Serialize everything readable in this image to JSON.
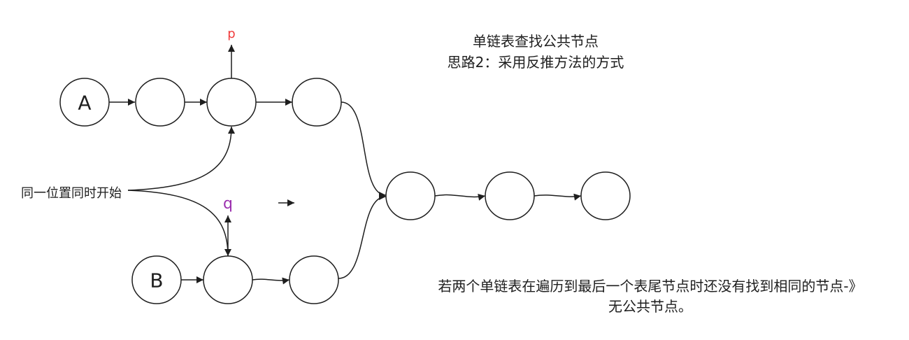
{
  "title": {
    "line1": "单链表查找公共节点",
    "line2": "思路2：采用反推方法的方式"
  },
  "list_a": {
    "head_label": "A"
  },
  "list_b": {
    "head_label": "B"
  },
  "pointers": {
    "p": "p",
    "q": "q"
  },
  "start_note": "同一位置同时开始",
  "conclusion": {
    "line1": "若两个单链表在遍历到最后一个表尾节点时还没有找到相同的节点-》",
    "line2": "无公共节点。"
  },
  "colors": {
    "pointer_p": "#f03c3c",
    "pointer_q": "#9b2fae",
    "stroke": "#1e1e1e"
  }
}
